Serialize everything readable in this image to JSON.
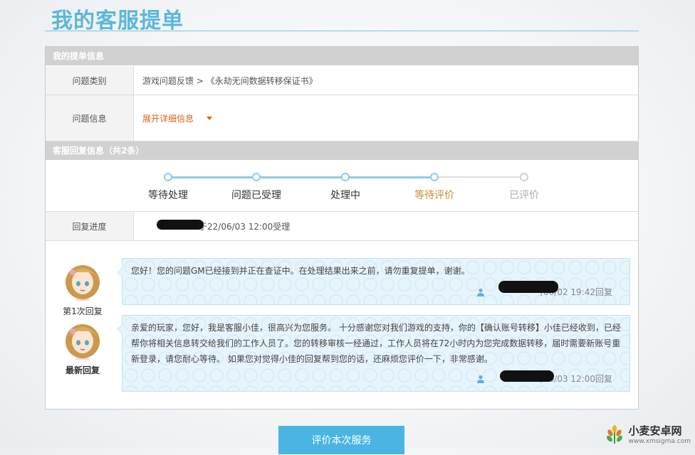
{
  "page": {
    "title": "我的客服提单",
    "accent_color": "#5bb7d9"
  },
  "ticket_info": {
    "section_title": "我的提单信息",
    "category_label": "问题类别",
    "category_value": "游戏问题反馈 > 《永劫无间数据转移保证书》",
    "details_label": "问题信息",
    "details_link": "展开详细信息",
    "details_icon": "caret-down-icon"
  },
  "reply_info": {
    "section_title": "客服回复信息（共2条）",
    "steps": [
      {
        "label": "等待处理",
        "state": "done"
      },
      {
        "label": "问题已受理",
        "state": "done"
      },
      {
        "label": "处理中",
        "state": "done"
      },
      {
        "label": "等待评价",
        "state": "current"
      },
      {
        "label": "已评价",
        "state": "todo"
      }
    ],
    "progress_label": "回复进度",
    "progress_text": "于22/06/03 12:00受理"
  },
  "replies": [
    {
      "label": "第1次回复",
      "message": "您好！您的问题GM已经接到并正在查证中。在处理结果出来之前，请勿重复提单，谢谢。",
      "meta": "/06/02 19:42回复",
      "avatar_icon": "customer-service-avatar-icon"
    },
    {
      "label": "最新回复",
      "message": "亲爱的玩家，您好，我是客服小佳，很高兴为您服务。   十分感谢您对我们游戏的支持，你的【确认账号转移】小佳已经收到，已经帮你将相关信息转交给我们的工作人员了。您的转移审核一经通过，工作人员将在72小时内为您完成数据转移，届时需要新账号重新登录，请您耐心等待。   如果您对觉得小佳的回复帮到您的话，还麻烦您评价一下，非常感谢。",
      "meta": "/06/03 12:00回复",
      "avatar_icon": "customer-service-avatar-icon"
    }
  ],
  "actions": {
    "rate_button": "评价本次服务",
    "button_color": "#4ab5e2"
  },
  "watermark": {
    "name": "小麦安卓网",
    "url": "www.xmsigma.com"
  }
}
